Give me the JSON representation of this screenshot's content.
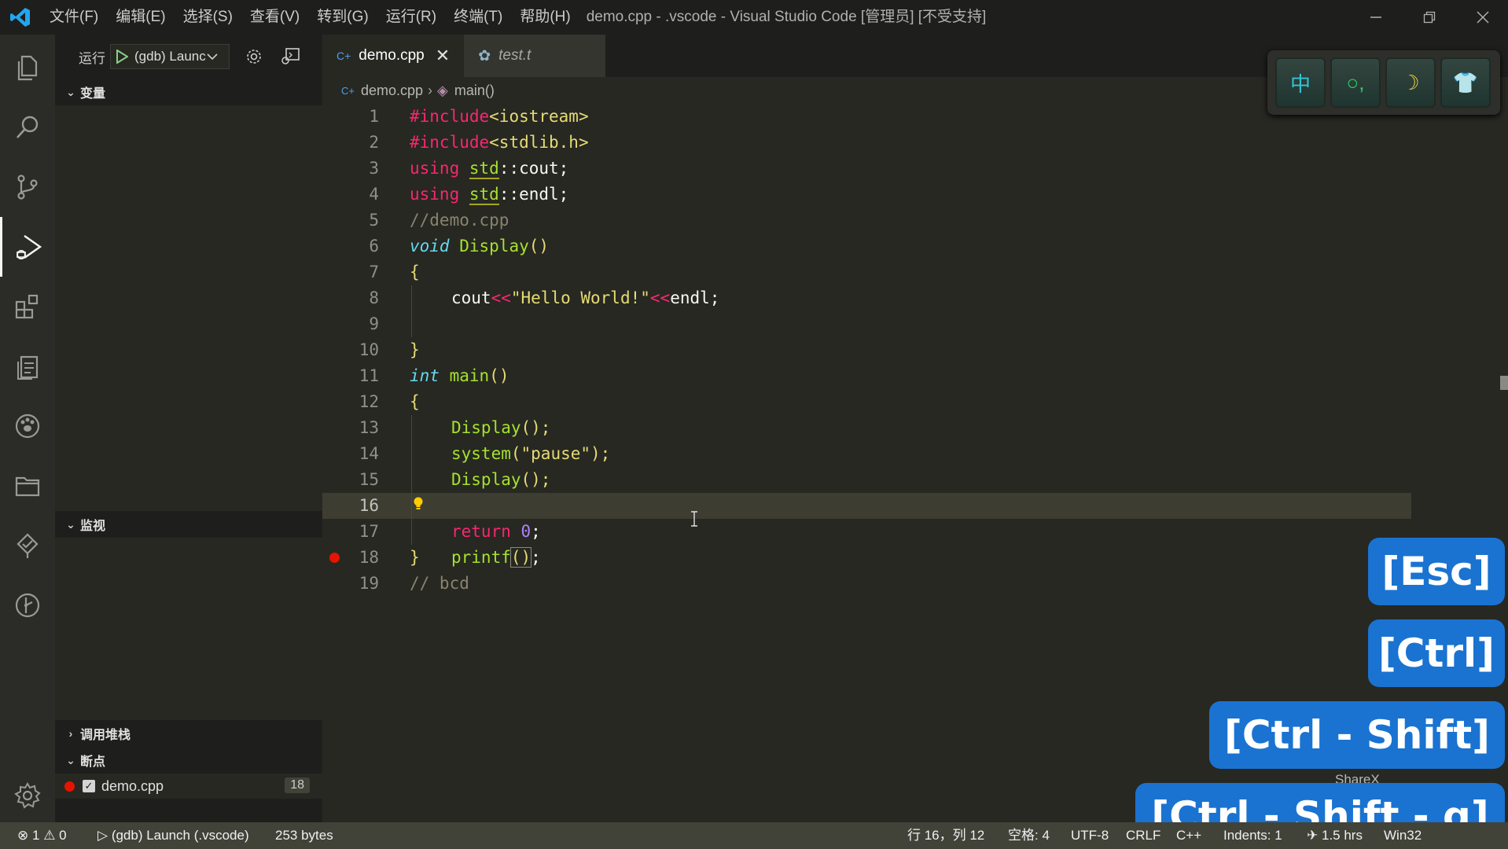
{
  "titlebar": {
    "menu": [
      "文件(F)",
      "编辑(E)",
      "选择(S)",
      "查看(V)",
      "转到(G)",
      "运行(R)",
      "终端(T)",
      "帮助(H)"
    ],
    "title": "demo.cpp - .vscode - Visual Studio Code [管理员] [不受支持]"
  },
  "sidebar": {
    "run_label": "运行",
    "config": "(gdb) Launc",
    "sections": {
      "variables": "变量",
      "watch": "监视",
      "callstack": "调用堆栈",
      "breakpoints": "断点"
    },
    "breakpoint_item": {
      "file": "demo.cpp",
      "line": "18"
    }
  },
  "tabs": [
    {
      "label": "demo.cpp",
      "active": true
    },
    {
      "label": "test.t",
      "active": false
    }
  ],
  "breadcrumb": {
    "file": "demo.cpp",
    "symbol": "main()"
  },
  "code": {
    "current_line": 16,
    "breakpoint_line": 18,
    "lines": [
      "1",
      "2",
      "3",
      "4",
      "5",
      "6",
      "7",
      "8",
      "9",
      "10",
      "11",
      "12",
      "13",
      "14",
      "15",
      "16",
      "17",
      "18",
      "19"
    ],
    "text": {
      "l1_kw": "#include",
      "l1_rest": "<iostream>",
      "l2_kw": "#include",
      "l2_rest": "<stdlib.h>",
      "l3_kw": "using",
      "l3_ns": "std",
      "l3_rest": "::cout;",
      "l4_kw": "using",
      "l4_ns": "std",
      "l4_rest": "::endl;",
      "l5": "//demo.cpp",
      "l6_type": "void",
      "l6_fn": "Display",
      "l6_rest": "()",
      "l7": "{",
      "l8_a": "cout",
      "l8_b": "<<",
      "l8_str": "\"Hello World!\"",
      "l8_c": "<<",
      "l8_d": "endl;",
      "l10": "}",
      "l11_type": "int",
      "l11_fn": "main",
      "l11_rest": "()",
      "l12": "{",
      "l13_fn": "Display",
      "l13_rest": "();",
      "l14_fn": "system",
      "l14_a": "(",
      "l14_str": "\"pause\"",
      "l14_b": ");",
      "l15_fn": "Display",
      "l15_rest": "();",
      "l16_fn": "printf",
      "l16_brk": "()",
      "l16_rest": ";",
      "l17_kw": "return",
      "l17_num": "0",
      "l17_rest": ";",
      "l18": "}",
      "l19": "// bcd"
    }
  },
  "ime": [
    "中",
    "○,",
    "☽",
    "👕"
  ],
  "keycast": [
    "[Esc]",
    "[Ctrl]",
    "[Ctrl - Shift]",
    "[Ctrl - Shift - g]"
  ],
  "sharex_label": "ShareX",
  "statusbar": {
    "errors": "1",
    "warnings": "0",
    "launch": "(gdb) Launch (.vscode)",
    "size": "253 bytes",
    "position": "行 16，列 12",
    "spaces": "空格: 4",
    "encoding": "UTF-8",
    "eol": "CRLF",
    "language": "C++",
    "indents": "Indents: 1",
    "time": "1.5 hrs",
    "platform": "Win32"
  },
  "colors": {
    "accent": "#1a73d1",
    "breakpoint": "#e51400",
    "keyword": "#f92672",
    "function": "#a6e22e",
    "string": "#e6db74",
    "type": "#66d9ef"
  }
}
